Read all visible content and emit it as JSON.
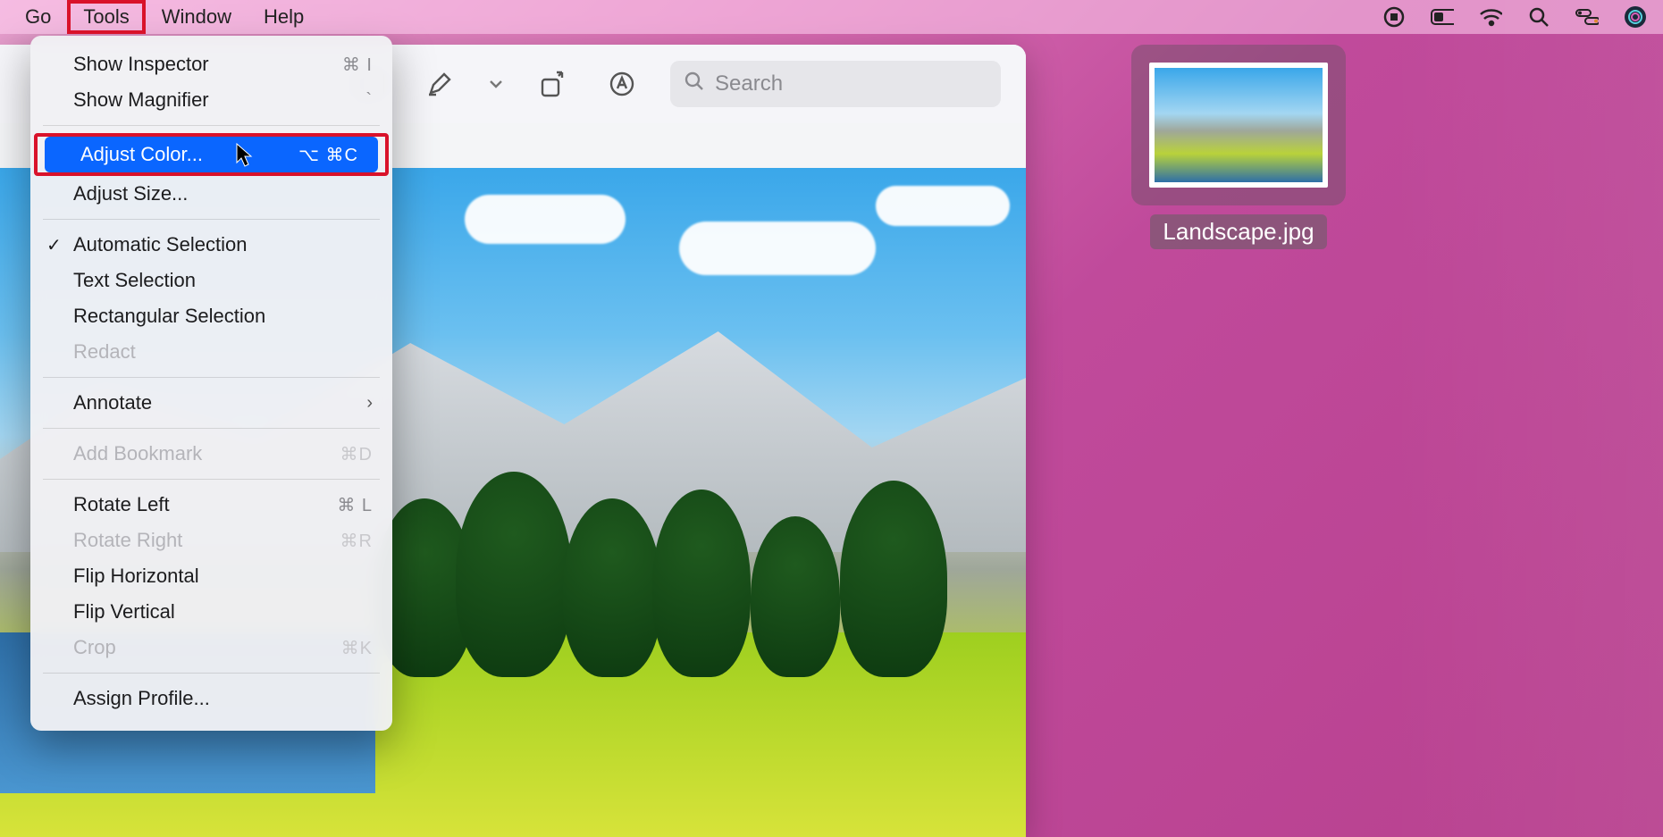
{
  "menubar": {
    "items": [
      "Go",
      "Tools",
      "Window",
      "Help"
    ],
    "active_index": 1
  },
  "tray": {
    "icons": [
      "record-icon",
      "battery-icon",
      "wifi-icon",
      "spotlight-icon",
      "control-center-icon",
      "siri-icon"
    ]
  },
  "toolbar": {
    "buttons": [
      "sidebar-icon",
      "edit-icon",
      "edit-dropdown-icon",
      "rotate-icon",
      "markup-icon"
    ],
    "search_placeholder": "Search"
  },
  "dropdown": {
    "groups": [
      [
        {
          "label": "Show Inspector",
          "shortcut": "⌘ I"
        },
        {
          "label": "Show Magnifier",
          "shortcut": "`"
        }
      ],
      [
        {
          "label": "Adjust Color...",
          "shortcut": "⌥ ⌘C",
          "highlighted": true,
          "boxed": true
        },
        {
          "label": "Adjust Size..."
        }
      ],
      [
        {
          "label": "Automatic Selection",
          "checked": true
        },
        {
          "label": "Text Selection"
        },
        {
          "label": "Rectangular Selection"
        },
        {
          "label": "Redact",
          "disabled": true
        }
      ],
      [
        {
          "label": "Annotate",
          "submenu": true
        }
      ],
      [
        {
          "label": "Add Bookmark",
          "shortcut": "⌘D",
          "disabled": true
        }
      ],
      [
        {
          "label": "Rotate Left",
          "shortcut": "⌘ L"
        },
        {
          "label": "Rotate Right",
          "shortcut": "⌘R",
          "disabled": true
        },
        {
          "label": "Flip Horizontal"
        },
        {
          "label": "Flip Vertical"
        },
        {
          "label": "Crop",
          "shortcut": "⌘K",
          "disabled": true
        }
      ],
      [
        {
          "label": "Assign Profile..."
        }
      ]
    ]
  },
  "desktop_file": {
    "name": "Landscape.jpg"
  }
}
